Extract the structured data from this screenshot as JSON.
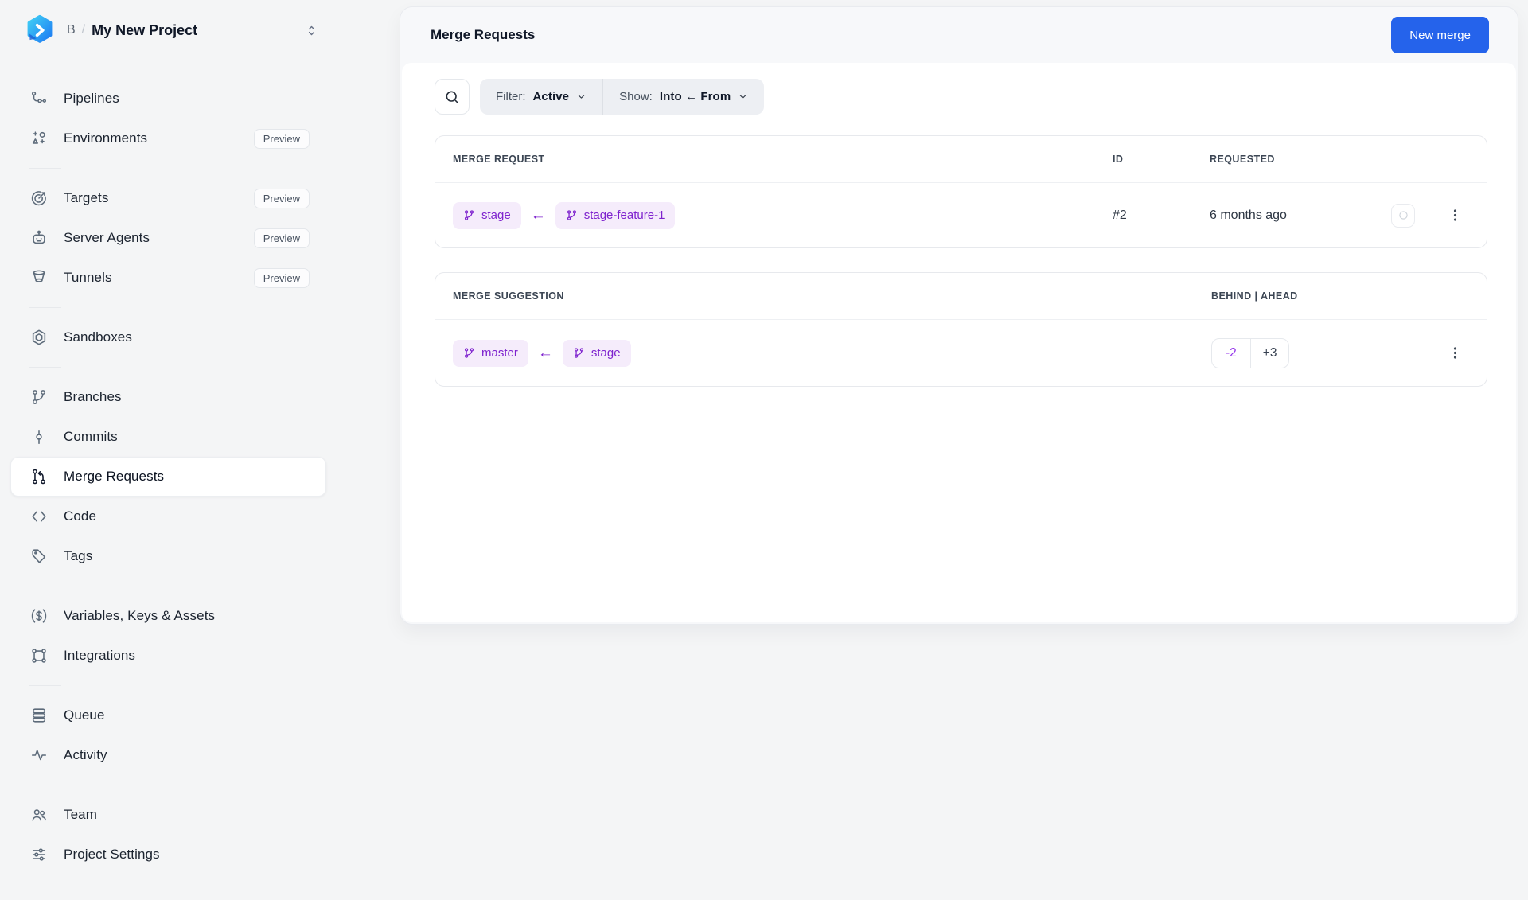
{
  "colors": {
    "page_bg": "#f4f5f6",
    "primary_blue": "#2563eb",
    "branch_badge_bg": "#f5ecfb",
    "branch_badge_text": "#7e22ce",
    "behind_purple": "#9333ea"
  },
  "sidebar": {
    "project": {
      "org_initial": "B",
      "separator": "/",
      "name": "My New Project"
    },
    "groups": [
      {
        "items": [
          {
            "label": "Pipelines",
            "icon": "pipelines-icon"
          },
          {
            "label": "Environments",
            "icon": "environments-icon",
            "badge": "Preview"
          }
        ]
      },
      {
        "items": [
          {
            "label": "Targets",
            "icon": "targets-icon",
            "badge": "Preview"
          },
          {
            "label": "Server Agents",
            "icon": "server-agents-icon",
            "badge": "Preview"
          },
          {
            "label": "Tunnels",
            "icon": "tunnels-icon",
            "badge": "Preview"
          }
        ]
      },
      {
        "items": [
          {
            "label": "Sandboxes",
            "icon": "sandboxes-icon"
          }
        ]
      },
      {
        "items": [
          {
            "label": "Branches",
            "icon": "branches-icon"
          },
          {
            "label": "Commits",
            "icon": "commits-icon"
          },
          {
            "label": "Merge Requests",
            "icon": "merge-requests-icon",
            "active": true
          },
          {
            "label": "Code",
            "icon": "code-icon"
          },
          {
            "label": "Tags",
            "icon": "tags-icon"
          }
        ]
      },
      {
        "items": [
          {
            "label": "Variables, Keys & Assets",
            "icon": "variables-icon"
          },
          {
            "label": "Integrations",
            "icon": "integrations-icon"
          }
        ]
      },
      {
        "items": [
          {
            "label": "Queue",
            "icon": "queue-icon"
          },
          {
            "label": "Activity",
            "icon": "activity-icon"
          }
        ]
      },
      {
        "items": [
          {
            "label": "Team",
            "icon": "team-icon"
          },
          {
            "label": "Project Settings",
            "icon": "project-settings-icon"
          }
        ]
      }
    ]
  },
  "header": {
    "title": "Merge Requests",
    "new_merge_label": "New merge"
  },
  "toolbar": {
    "filter": {
      "prefix": "Filter:",
      "value": "Active"
    },
    "show": {
      "prefix": "Show:",
      "value": "Into ← From"
    }
  },
  "merge_request_table": {
    "columns": {
      "main": "MERGE REQUEST",
      "id": "ID",
      "requested": "REQUESTED"
    },
    "row": {
      "into_branch": "stage",
      "arrow": "←",
      "from_branch": "stage-feature-1",
      "id": "#2",
      "requested": "6 months ago"
    }
  },
  "merge_suggestion_table": {
    "columns": {
      "main": "MERGE SUGGESTION",
      "behind_ahead": "BEHIND | AHEAD"
    },
    "row": {
      "into_branch": "master",
      "arrow": "←",
      "from_branch": "stage",
      "behind": "-2",
      "ahead": "+3"
    }
  }
}
